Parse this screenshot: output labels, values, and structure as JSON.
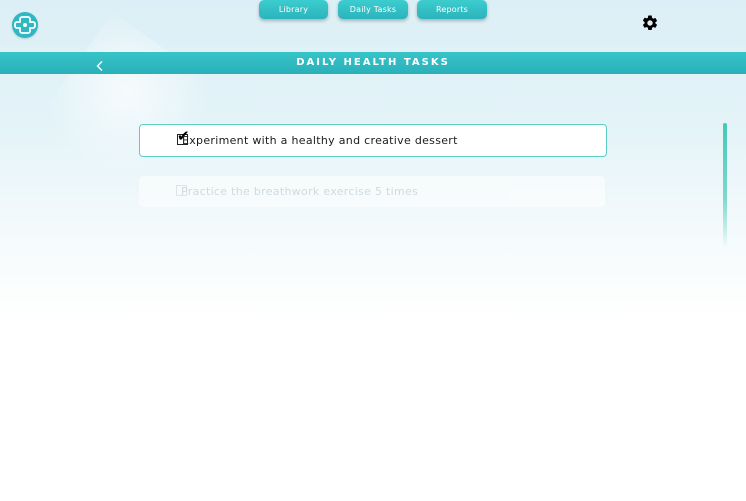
{
  "app": {
    "logo_icon": "medical-cross-logo-icon",
    "accent_color": "#2fb8c4"
  },
  "nav": {
    "items": [
      {
        "label": "Library"
      },
      {
        "label": "Daily Tasks"
      },
      {
        "label": "Reports"
      }
    ]
  },
  "settings": {
    "icon": "gear-icon"
  },
  "header": {
    "title": "DAILY HEALTH TASKS",
    "back_icon": "chevron-left-icon"
  },
  "tasks": [
    {
      "label": "Experiment with a healthy and creative dessert",
      "checked": true
    },
    {
      "label": "Practice the breathwork exercise 5 times",
      "checked": false
    }
  ]
}
